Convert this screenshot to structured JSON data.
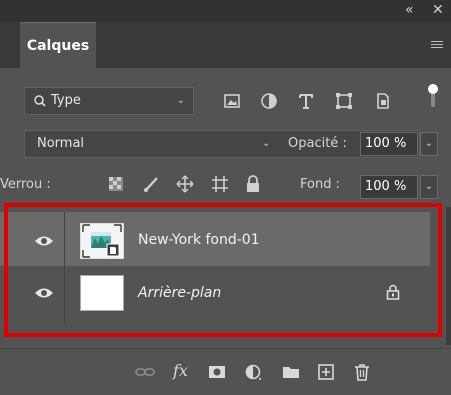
{
  "window": {
    "collapse_icon": "«",
    "close_icon": "✕"
  },
  "panel": {
    "tab_label": "Calques",
    "menu_icon": "panel-menu-icon"
  },
  "filter": {
    "kind_label": "Type",
    "icons": [
      "image-filter-icon",
      "adjustment-filter-icon",
      "text-filter-icon",
      "shape-filter-icon",
      "smart-object-filter-icon"
    ],
    "switch_state": "on"
  },
  "blend": {
    "mode": "Normal",
    "opacity_label": "Opacité :",
    "opacity_value": "100 %"
  },
  "lock": {
    "label": "Verrou :",
    "icons": [
      "lock-transparent-icon",
      "lock-image-icon",
      "lock-position-icon",
      "lock-artboard-icon",
      "lock-all-icon"
    ],
    "fill_label": "Fond :",
    "fill_value": "100 %"
  },
  "layers": [
    {
      "name": "New-York fond-01",
      "visible": true,
      "selected": true,
      "type": "smart-object"
    },
    {
      "name": "Arrière-plan",
      "visible": true,
      "selected": false,
      "locked": true,
      "type": "background"
    }
  ],
  "toolbar_icons": [
    "link-layers-icon",
    "fx-icon",
    "add-mask-icon",
    "new-adjustment-icon",
    "new-group-icon",
    "new-layer-icon",
    "delete-layer-icon"
  ],
  "toolbar": {
    "fx_label": "fx"
  },
  "colors": {
    "panel_bg": "#535353",
    "selected_row": "#6a6a6a",
    "highlight": "#e00000"
  }
}
